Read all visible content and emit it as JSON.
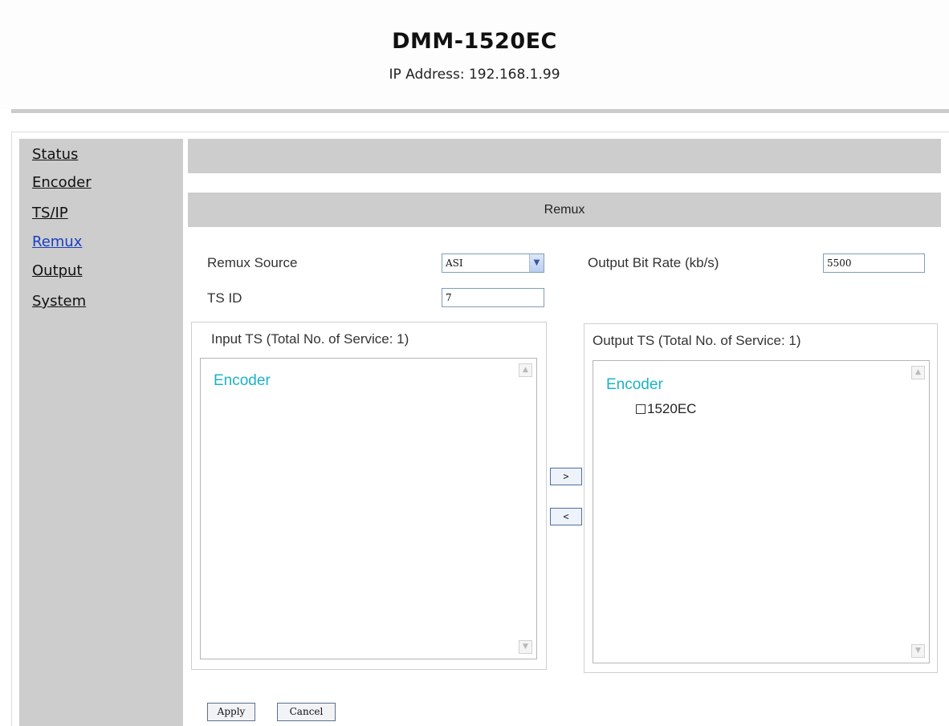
{
  "header": {
    "title": "DMM-1520EC",
    "ip_address": "IP Address: 192.168.1.99"
  },
  "sidebar": {
    "items": [
      {
        "label": "Status",
        "active": false
      },
      {
        "label": "Encoder",
        "active": false
      },
      {
        "label": "TS/IP",
        "active": false
      },
      {
        "label": "Remux",
        "active": true
      },
      {
        "label": "Output",
        "active": false
      },
      {
        "label": "System",
        "active": false
      }
    ]
  },
  "main": {
    "section_title": "Remux",
    "remux_source": {
      "label": "Remux Source",
      "value": "ASI"
    },
    "ts_id": {
      "label": "TS ID",
      "value": "7"
    },
    "output_bit_rate": {
      "label": "Output Bit Rate (kb/s)",
      "value": "5500"
    },
    "input_ts": {
      "title": "Input TS (Total No. of Service: 1)",
      "group": "Encoder",
      "services": []
    },
    "output_ts": {
      "title": "Output TS (Total No. of Service: 1)",
      "group": "Encoder",
      "services": [
        "1520EC"
      ]
    },
    "move_right_label": ">",
    "move_left_label": "<",
    "apply_label": "Apply",
    "cancel_label": "Cancel"
  },
  "colors": {
    "sidebar_bg": "#cdcdcd",
    "active_link": "#1a3fbf",
    "tree_group": "#1ab3c7"
  }
}
